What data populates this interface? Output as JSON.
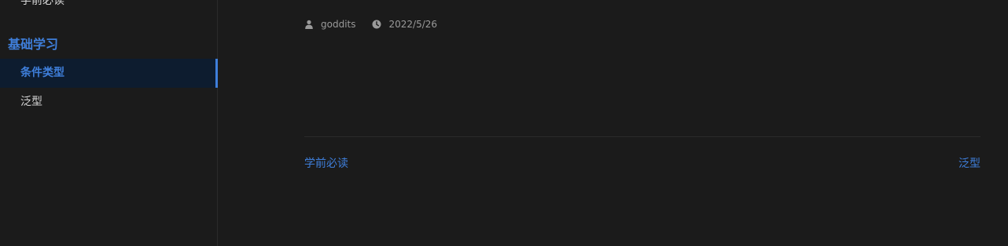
{
  "sidebar": {
    "prev_item_partial": "学前必读",
    "group_title": "基础学习",
    "items": [
      {
        "label": "条件类型",
        "active": true
      },
      {
        "label": "泛型",
        "active": false
      }
    ]
  },
  "meta": {
    "author": "goddits",
    "date": "2022/5/26",
    "author_icon": "user-icon",
    "date_icon": "clock-icon"
  },
  "page_nav": {
    "prev_label": "学前必读",
    "next_label": "泛型"
  },
  "colors": {
    "accent": "#3f7fdb",
    "background": "#1b1b1b",
    "active_bg": "#0d1c2f"
  }
}
